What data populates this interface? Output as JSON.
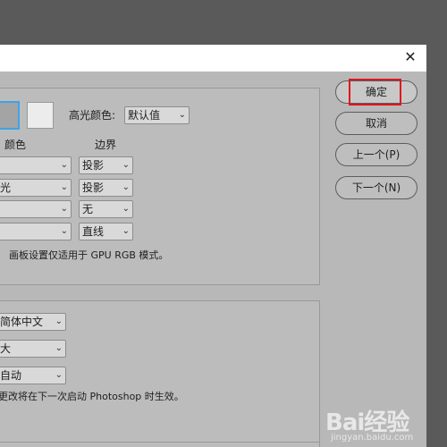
{
  "dialog": {
    "close_glyph": "✕"
  },
  "group1": {
    "highlight_color_label": "高光颜色:",
    "highlight_color_value": "默认值",
    "col_color": "颜色",
    "col_border": "边界",
    "rows": [
      {
        "color": "",
        "border": "投影"
      },
      {
        "color": "光",
        "border": "投影"
      },
      {
        "color": "",
        "border": "无"
      },
      {
        "color": "",
        "border": "直线"
      }
    ],
    "note": "画板设置仅适用于 GPU RGB 模式。"
  },
  "group2": {
    "lang_value": "简体中文",
    "size_value": "大",
    "scale_value": "自动",
    "note": "更改将在下一次启动 Photoshop 时生效。"
  },
  "buttons": {
    "ok": "确定",
    "cancel": "取消",
    "prev": "上一个(P)",
    "next": "下一个(N)"
  },
  "colors": {
    "highlight_box": "#e0141e",
    "focus_blue": "#3ea4e8"
  },
  "watermark": {
    "logo": "Bai经验",
    "url": "jingyan.baidu.com"
  }
}
